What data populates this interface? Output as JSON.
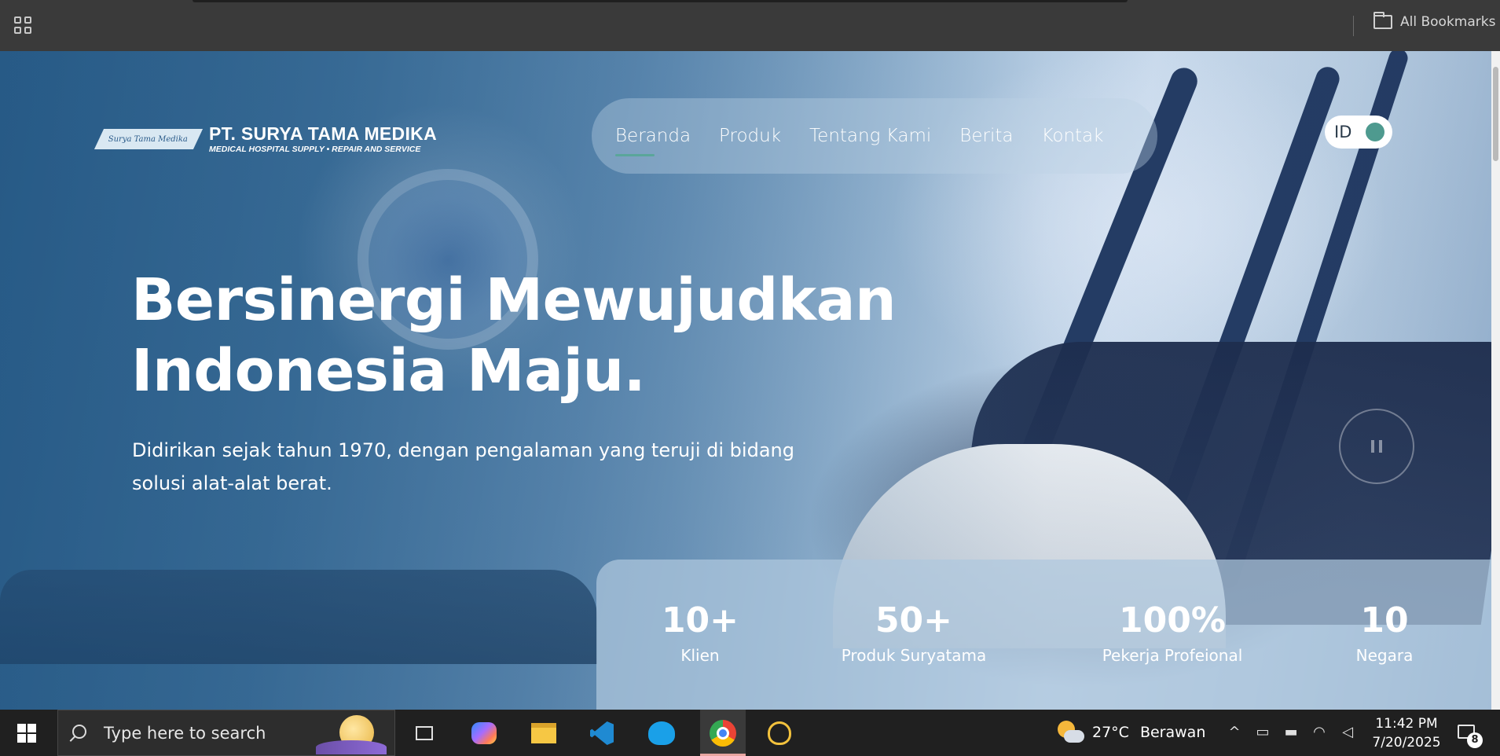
{
  "browser": {
    "bookmarks_label": "All Bookmarks",
    "apps_icon": "apps-grid-icon",
    "folder_icon": "folder-icon"
  },
  "site": {
    "logo_mark_text": "Surya Tama Medika",
    "company_name": "PT. SURYA TAMA MEDIKA",
    "company_tagline": "MEDICAL HOSPITAL SUPPLY • REPAIR AND SERVICE",
    "nav": [
      {
        "label": "Beranda",
        "active": true
      },
      {
        "label": "Produk",
        "active": false
      },
      {
        "label": "Tentang Kami",
        "active": false
      },
      {
        "label": "Berita",
        "active": false
      },
      {
        "label": "Kontak",
        "active": false
      }
    ],
    "language": "ID",
    "accent_color": "#4e9a8f"
  },
  "hero": {
    "headline_line1": "Bersinergi Mewujudkan",
    "headline_line2": "Indonesia Maju.",
    "subline": "Didirikan sejak tahun 1970, dengan pengalaman yang teruji di bidang solusi alat-alat berat.",
    "pause_icon": "pause-icon"
  },
  "stats": [
    {
      "value": "10+",
      "label": "Klien"
    },
    {
      "value": "50+",
      "label": "Produk Suryatama"
    },
    {
      "value": "100%",
      "label": "Pekerja Profeional"
    },
    {
      "value": "10",
      "label": "Negara"
    }
  ],
  "taskbar": {
    "search_placeholder": "Type here to search",
    "apps": [
      "task-view-icon",
      "copilot-icon",
      "file-explorer-icon",
      "vscode-icon",
      "elephant-app-icon",
      "chrome-icon",
      "paw-app-icon"
    ],
    "weather_temp": "27°C",
    "weather_condition": "Berawan",
    "time": "11:42 PM",
    "date": "7/20/2025",
    "notification_count": "8"
  }
}
